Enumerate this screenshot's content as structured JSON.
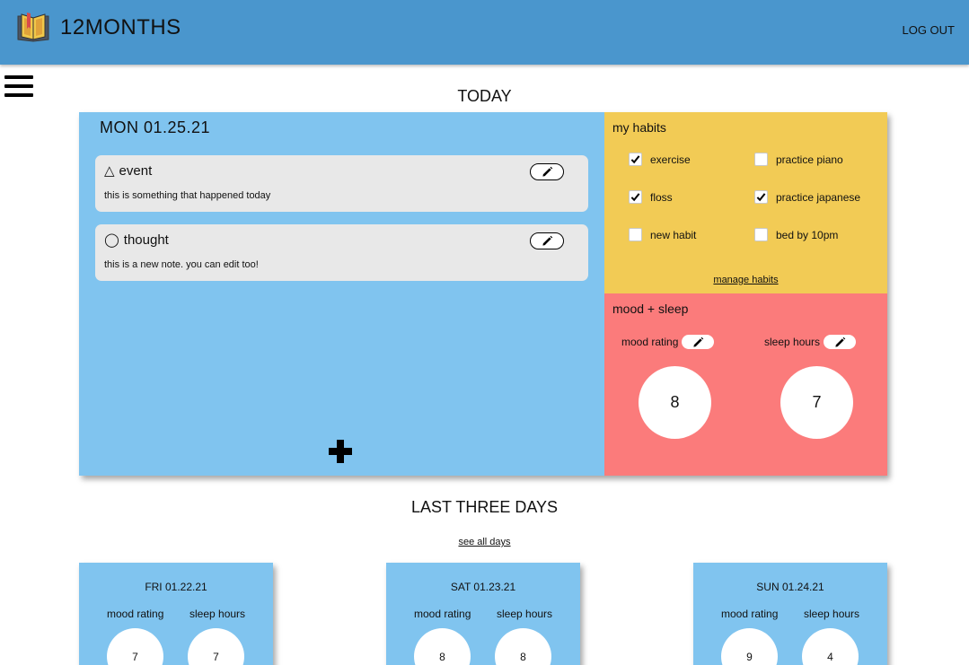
{
  "header": {
    "brand": "12MONTHS",
    "logout": "LOG OUT",
    "colors": {
      "bar": "#4a96cd"
    }
  },
  "menu": {
    "icon": "hamburger-icon"
  },
  "today": {
    "heading": "TODAY",
    "date": "MON 01.25.21",
    "notes": [
      {
        "icon": "△",
        "title": "event",
        "body": "this is something that happened today"
      },
      {
        "icon": "◯",
        "title": "thought",
        "body": "this is a new note. you can edit too!"
      }
    ],
    "add_icon": "plus-icon",
    "colors": {
      "notes_panel": "#80c4ef",
      "habits_panel": "#f2cb55",
      "mood_panel": "#fb7b7b"
    }
  },
  "habits": {
    "title": "my habits",
    "items": [
      {
        "label": "exercise",
        "checked": true
      },
      {
        "label": "practice piano",
        "checked": false
      },
      {
        "label": "floss",
        "checked": true
      },
      {
        "label": "practice japanese",
        "checked": true
      },
      {
        "label": "new habit",
        "checked": false
      },
      {
        "label": "bed by 10pm",
        "checked": false
      }
    ],
    "manage_link": "manage habits"
  },
  "mood_sleep": {
    "title": "mood + sleep",
    "mood_label": "mood rating",
    "sleep_label": "sleep hours",
    "mood_value": "8",
    "sleep_value": "7"
  },
  "last_three": {
    "heading": "LAST THREE DAYS",
    "see_all": "see all days",
    "days": [
      {
        "date": "FRI 01.22.21",
        "mood_label": "mood rating",
        "sleep_label": "sleep hours",
        "mood": "7",
        "sleep": "7"
      },
      {
        "date": "SAT 01.23.21",
        "mood_label": "mood rating",
        "sleep_label": "sleep hours",
        "mood": "8",
        "sleep": "8"
      },
      {
        "date": "SUN 01.24.21",
        "mood_label": "mood rating",
        "sleep_label": "sleep hours",
        "mood": "9",
        "sleep": "4"
      }
    ]
  }
}
